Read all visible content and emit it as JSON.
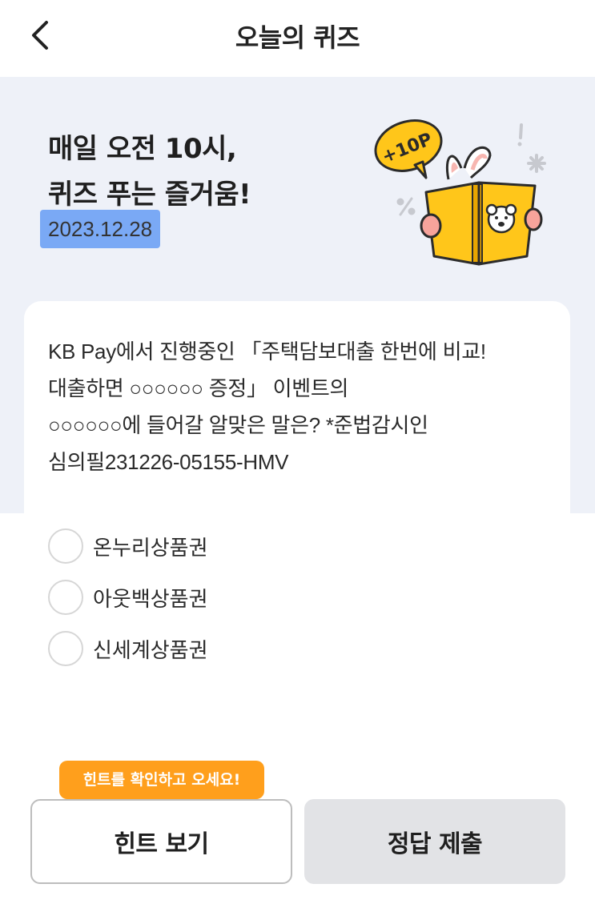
{
  "header": {
    "title": "오늘의 퀴즈",
    "back_icon": "chevron-left-icon"
  },
  "hero": {
    "title_line1": "매일 오전 10시,",
    "title_line2": "퀴즈 푸는 즐거움!",
    "date": "2023.12.28",
    "badge_text": "+10P",
    "highlight_color": "#7aa9f5",
    "background_color": "#eef1f8"
  },
  "quiz": {
    "question_lines": [
      "KB Pay에서 진행중인 「주택담보대출 한번에 비교!",
      "대출하면 ○○○○○○ 증정」 이벤트의",
      "○○○○○○에 들어갈 알맞은 말은? *준법감시인",
      "심의필231226-05155-HMV"
    ],
    "options": [
      {
        "label": "온누리상품권"
      },
      {
        "label": "아웃백상품권"
      },
      {
        "label": "신세계상품권"
      }
    ]
  },
  "footer": {
    "tooltip": "힌트를 확인하고 오세요!",
    "hint_button": "힌트 보기",
    "submit_button": "정답 제출",
    "tooltip_color": "#ff9f1c"
  }
}
